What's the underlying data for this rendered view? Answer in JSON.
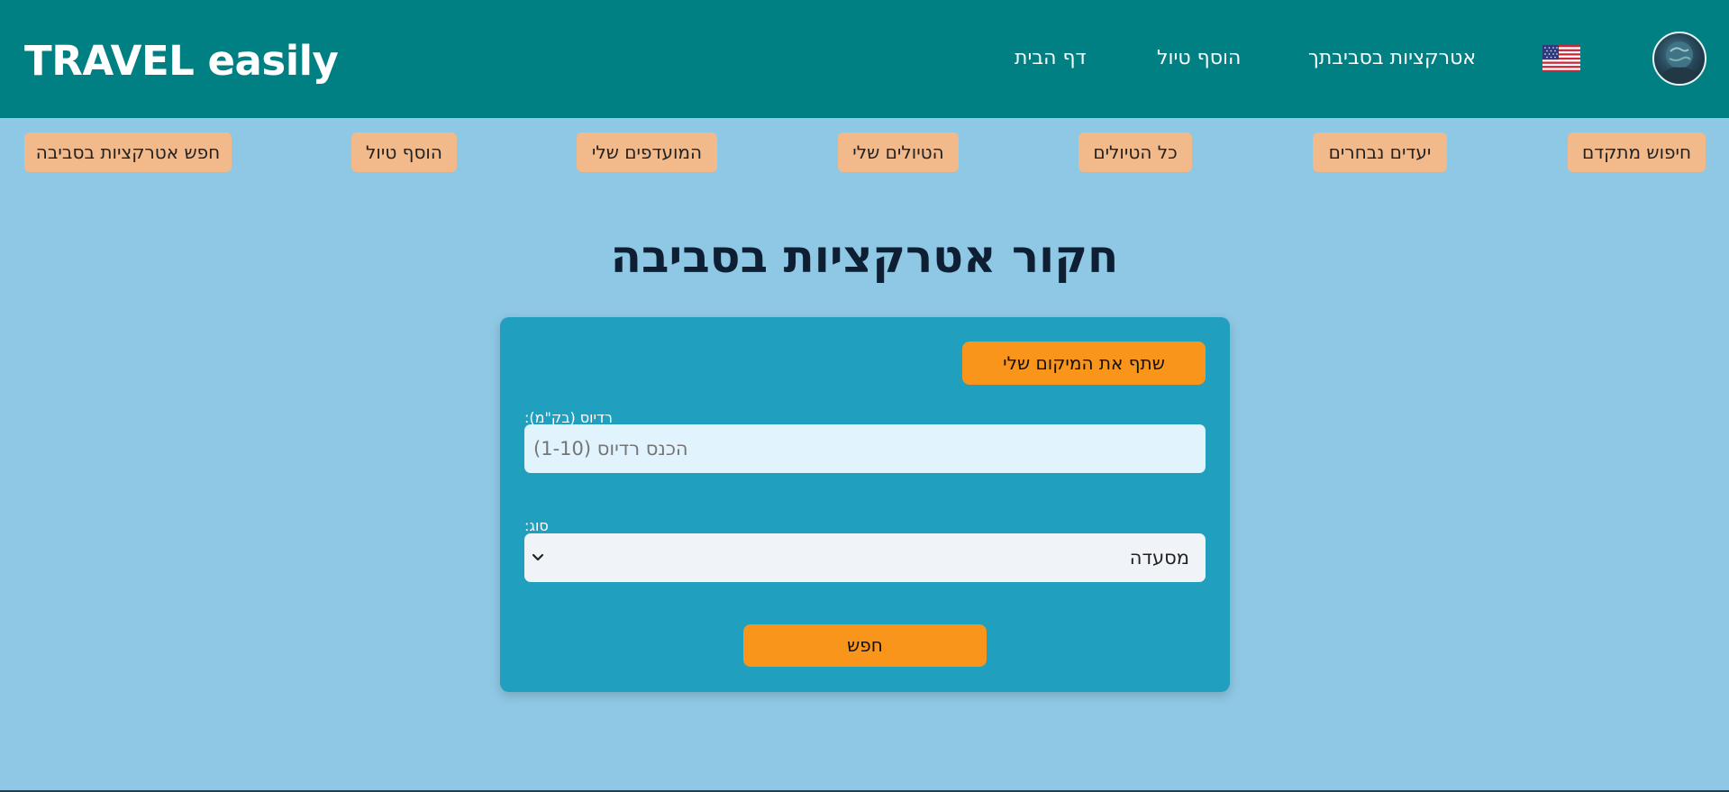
{
  "header": {
    "brand": "TRAVEL easily",
    "nav": {
      "home": "דף הבית",
      "add_trip": "הוסף טיול",
      "nearby_attractions": "אטרקציות בסביבתך"
    },
    "flag_icon": "us-flag-icon",
    "avatar_icon": "profile-avatar-globe"
  },
  "subnav": {
    "advanced_search": "חיפוש מתקדם",
    "chosen_destinations": "יעדים נבחרים",
    "all_trips": "כל הטיולים",
    "my_trips": "הטיולים שלי",
    "my_favorites": "המועדפים שלי",
    "add_trip": "הוסף טיול",
    "search_nearby": "חפש אטרקציות בסביבה"
  },
  "page": {
    "title": "חקור אטרקציות בסביבה"
  },
  "form": {
    "share_location": "שתף את המיקום שלי",
    "radius_label": "רדיוס (בק\"מ):",
    "radius_placeholder": "הכנס רדיוס (1-10)",
    "type_label": "סוג:",
    "type_value": "מסעדה",
    "submit": "חפש"
  },
  "colors": {
    "header_bg": "#018083",
    "page_bg": "#8fc8e5",
    "subnav_btn": "#f2b98a",
    "card_bg": "#219fbf",
    "accent": "#fa951b"
  }
}
